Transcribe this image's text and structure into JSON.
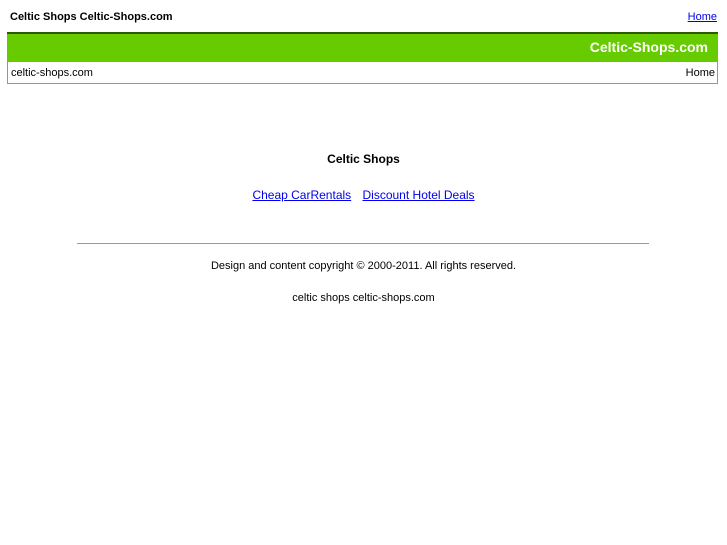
{
  "top_bar": {
    "heading": "Celtic Shops Celtic-Shops.com",
    "home_link": "Home"
  },
  "header": {
    "brand": "Celtic-Shops.com",
    "domain": "celtic-shops.com",
    "home": "Home"
  },
  "colors": {
    "band_green": "#66cc00",
    "band_border_dark": "#2d5a00",
    "link_blue": "#0000ee"
  },
  "main": {
    "title": "Celtic Shops",
    "links": [
      "Cheap CarRentals",
      "Discount Hotel Deals"
    ]
  },
  "footer": {
    "copyright": "Design and content copyright © 2000-2011. All rights reserved.",
    "keywords": "celtic shops celtic-shops.com"
  }
}
